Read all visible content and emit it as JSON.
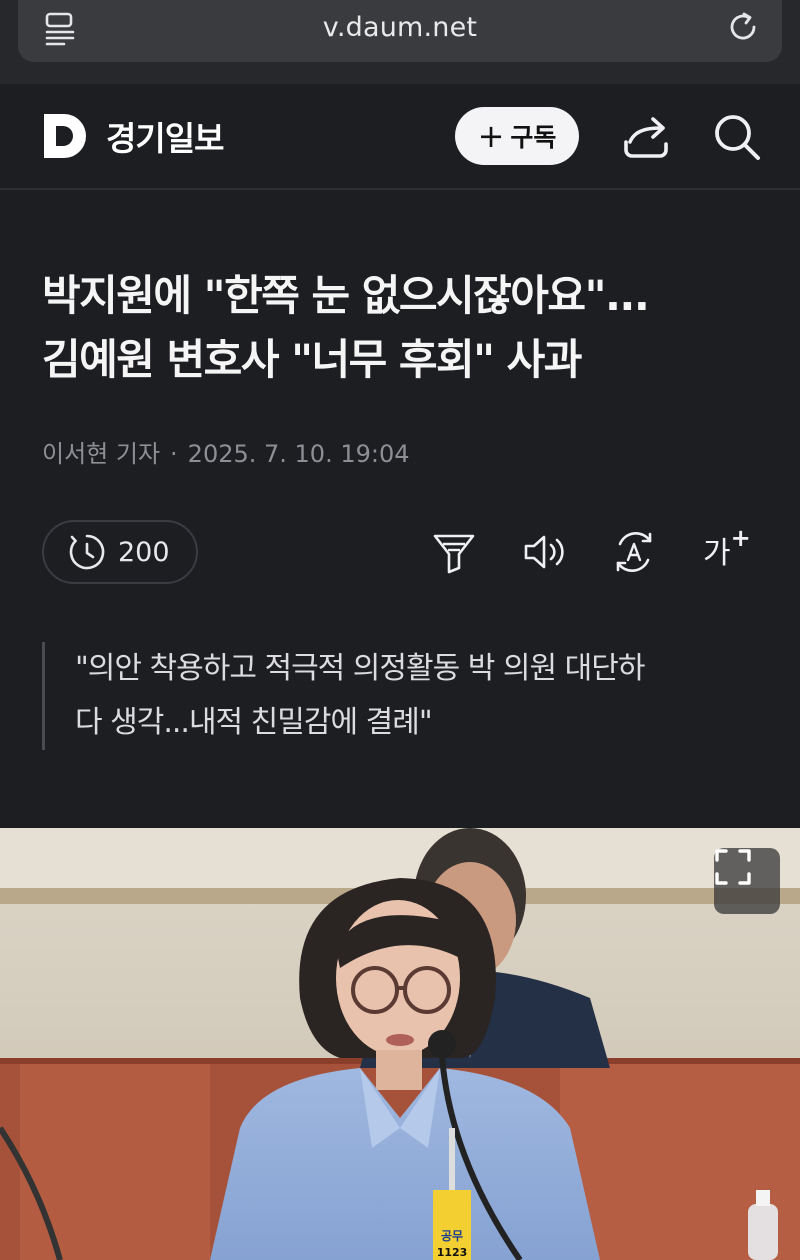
{
  "browser": {
    "url": "v.daum.net",
    "reader_icon": "reader-view-icon",
    "reload_icon": "reload-icon"
  },
  "header": {
    "logo_letter": "D",
    "site_name": "경기일보",
    "subscribe_label": "구독",
    "subscribe_plus": "+",
    "share_icon": "share-icon",
    "search_icon": "search-icon"
  },
  "article": {
    "headline_line1": "박지원에 \"한쪽 눈 없으시잖아요\"...",
    "headline_line2": "김예원 변호사 \"너무 후회\" 사과",
    "author": "이서현 기자",
    "separator": "·",
    "timestamp": "2025. 7. 10. 19:04",
    "summary_line1": "\"의안 착용하고 적극적 의정활동 박 의원 대단하",
    "summary_line2": "다 생각...내적 친밀감에 결례\""
  },
  "toolbar": {
    "comment_count": "200",
    "comment_icon": "comment-clock-icon",
    "filter_icon": "summary-filter-icon",
    "speaker_icon": "speaker-icon",
    "translate_icon": "translate-icon",
    "font_size_label": "가",
    "font_size_plus": "+"
  },
  "photo": {
    "badge_text": "공무",
    "badge_number": "1123",
    "fullscreen_icon": "fullscreen-icon"
  },
  "colors": {
    "background": "#1d1e22",
    "browser_bar": "#27282b",
    "headline": "#f5f5f6",
    "byline": "#8e8f94"
  }
}
